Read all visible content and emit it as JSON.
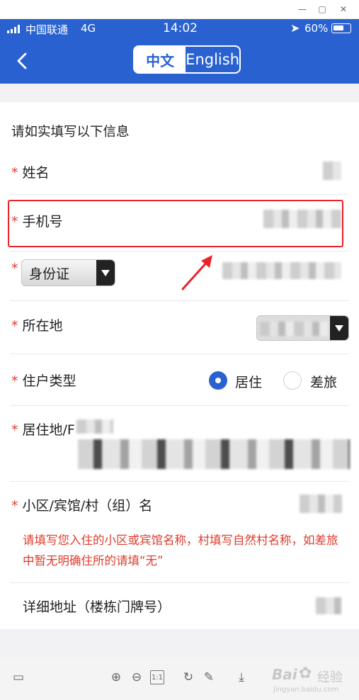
{
  "status": {
    "carrier": "中国联通",
    "network": "4G",
    "time": "14:02",
    "battery": "60%"
  },
  "nav": {
    "lang_zh": "中文",
    "lang_en": "English"
  },
  "form": {
    "intro": "请如实填写以下信息",
    "required_mark": "*",
    "name_label": "姓名",
    "phone_label": "手机号",
    "id_type_value": "身份证",
    "location_label": "所在地",
    "resident_type_label": "住户类型",
    "resident_option": "居住",
    "travel_option": "差旅",
    "residence_label": "居住地/F",
    "community_label": "小区/宾馆/村（组）名",
    "hint_text": "请填写您入住的小区或宾馆名称，村填写自然村名称，如差旅中暂无明确住所的请填“无”",
    "address_label": "详细地址（楼栋门牌号）"
  },
  "watermark": {
    "brand": "Bai",
    "cn": "经验",
    "url": "jingyan.baidu.com"
  },
  "colors": {
    "accent": "#2962d0",
    "required": "#e03a2c",
    "highlight": "#e8232a"
  }
}
